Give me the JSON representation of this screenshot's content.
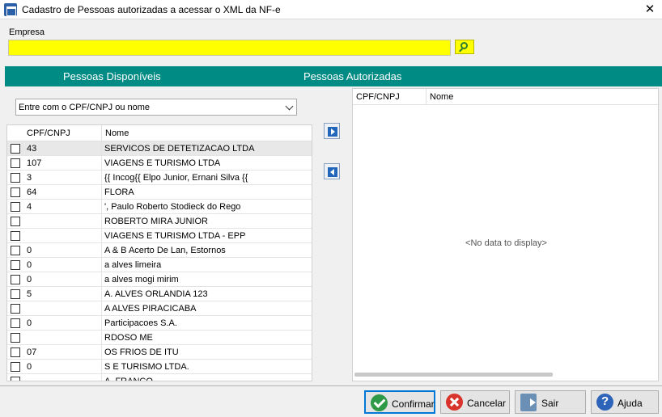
{
  "window": {
    "title": "Cadastro de Pessoas autorizadas a acessar o XML da NF-e",
    "close_glyph": "✕"
  },
  "empresa": {
    "label": "Empresa",
    "value": "",
    "field_color": "#ffff00",
    "search_icon": "search-icon"
  },
  "bands": {
    "disponiveis": "Pessoas Disponíveis",
    "autorizadas": "Pessoas Autorizadas",
    "color": "#008b85"
  },
  "filter": {
    "placeholder": "Entre com o CPF/CNPJ ou nome"
  },
  "left_grid": {
    "col_cpf": "CPF/CNPJ",
    "col_nome": "Nome",
    "rows": [
      {
        "cpf": "43",
        "nome": "SERVICOS DE DETETIZACAO LTDA"
      },
      {
        "cpf": "107",
        "nome": "VIAGENS E TURISMO LTDA"
      },
      {
        "cpf": "3",
        "nome": "{{ Incog{{ Elpo Junior, Ernani Silva {{"
      },
      {
        "cpf": "64",
        "nome": "FLORA"
      },
      {
        "cpf": "4",
        "nome": "', Paulo Roberto Stodieck do Rego"
      },
      {
        "cpf": "",
        "nome": "ROBERTO MIRA JUNIOR"
      },
      {
        "cpf": "",
        "nome": "VIAGENS E TURISMO LTDA - EPP"
      },
      {
        "cpf": "0",
        "nome": "A & B Acerto De Lan, Estornos"
      },
      {
        "cpf": "0",
        "nome": "a alves limeira"
      },
      {
        "cpf": "0",
        "nome": "a alves mogi mirim"
      },
      {
        "cpf": "5",
        "nome": "A. ALVES ORLANDIA 123"
      },
      {
        "cpf": "",
        "nome": "A ALVES PIRACICABA"
      },
      {
        "cpf": "0",
        "nome": "Participacoes S.A."
      },
      {
        "cpf": "",
        "nome": "RDOSO ME"
      },
      {
        "cpf": "07",
        "nome": "OS FRIOS DE ITU"
      },
      {
        "cpf": "0",
        "nome": "S E TURISMO LTDA."
      },
      {
        "cpf": "",
        "nome": "A. FRANCO"
      }
    ]
  },
  "move_buttons": {
    "add_icon": "arrow-right-icon",
    "remove_icon": "arrow-left-icon"
  },
  "right_grid": {
    "col_cpf": "CPF/CNPJ",
    "col_nome": "Nome",
    "empty_text": "<No data to display>"
  },
  "buttons": {
    "confirmar": "Confirmar",
    "cancelar": "Cancelar",
    "sair": "Sair",
    "ajuda": "Ajuda"
  }
}
